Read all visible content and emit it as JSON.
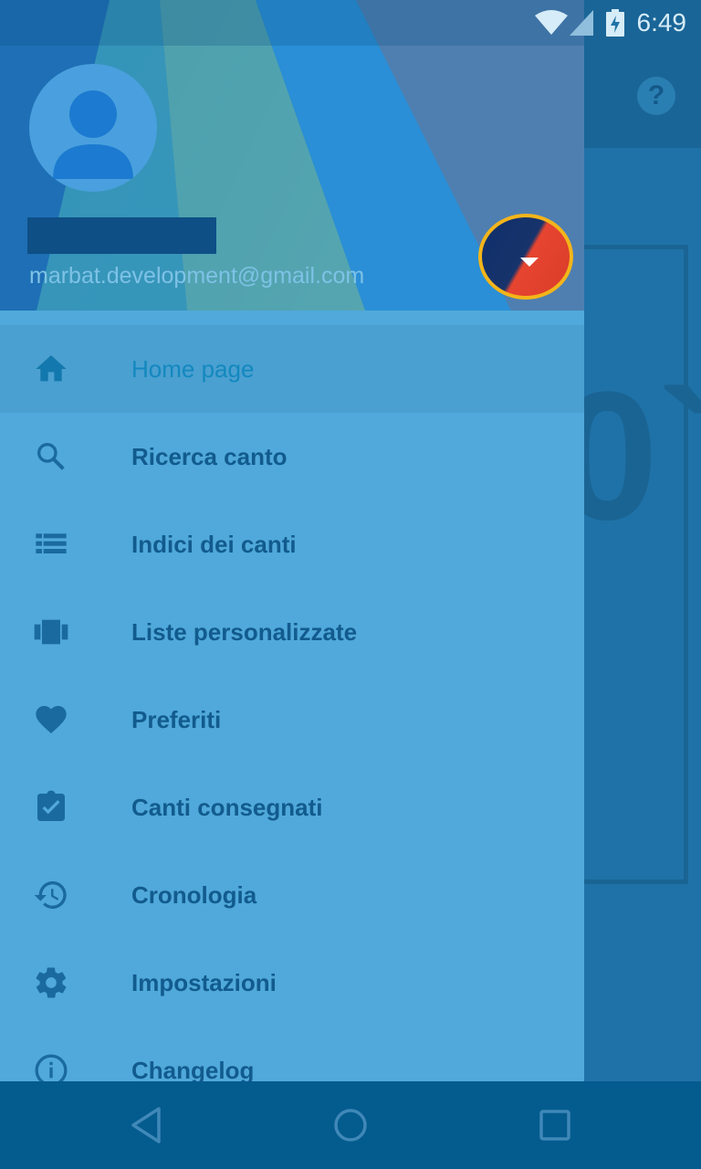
{
  "status_bar": {
    "time": "6:49",
    "icons": [
      "wifi-icon",
      "cell-signal-icon",
      "battery-charging-icon"
    ]
  },
  "background": {
    "help_icon": "help-icon"
  },
  "drawer": {
    "header": {
      "email": "marbat.development@gmail.com",
      "account_switch_icon": "dropdown-arrow-icon"
    },
    "menu": [
      {
        "label": "Home page",
        "icon": "home-icon",
        "active": true
      },
      {
        "label": "Ricerca canto",
        "icon": "search-icon"
      },
      {
        "label": "Indici dei canti",
        "icon": "list-icon"
      },
      {
        "label": "Liste personalizzate",
        "icon": "carousel-icon"
      },
      {
        "label": "Preferiti",
        "icon": "heart-icon"
      },
      {
        "label": "Canti consegnati",
        "icon": "clipboard-check-icon"
      },
      {
        "label": "Cronologia",
        "icon": "history-icon"
      },
      {
        "label": "Impostazioni",
        "icon": "gear-icon"
      },
      {
        "label": "Changelog",
        "icon": "info-icon"
      }
    ]
  },
  "nav_bar": {
    "buttons": [
      "back-icon",
      "home-circle-icon",
      "recents-icon"
    ]
  },
  "colors": {
    "drawer_bg": "#50a9da",
    "label_text": "#125b8e",
    "active_label": "#1388bf",
    "nav_bar": "#045b8e",
    "highlight_ring": "#f3b51a"
  }
}
